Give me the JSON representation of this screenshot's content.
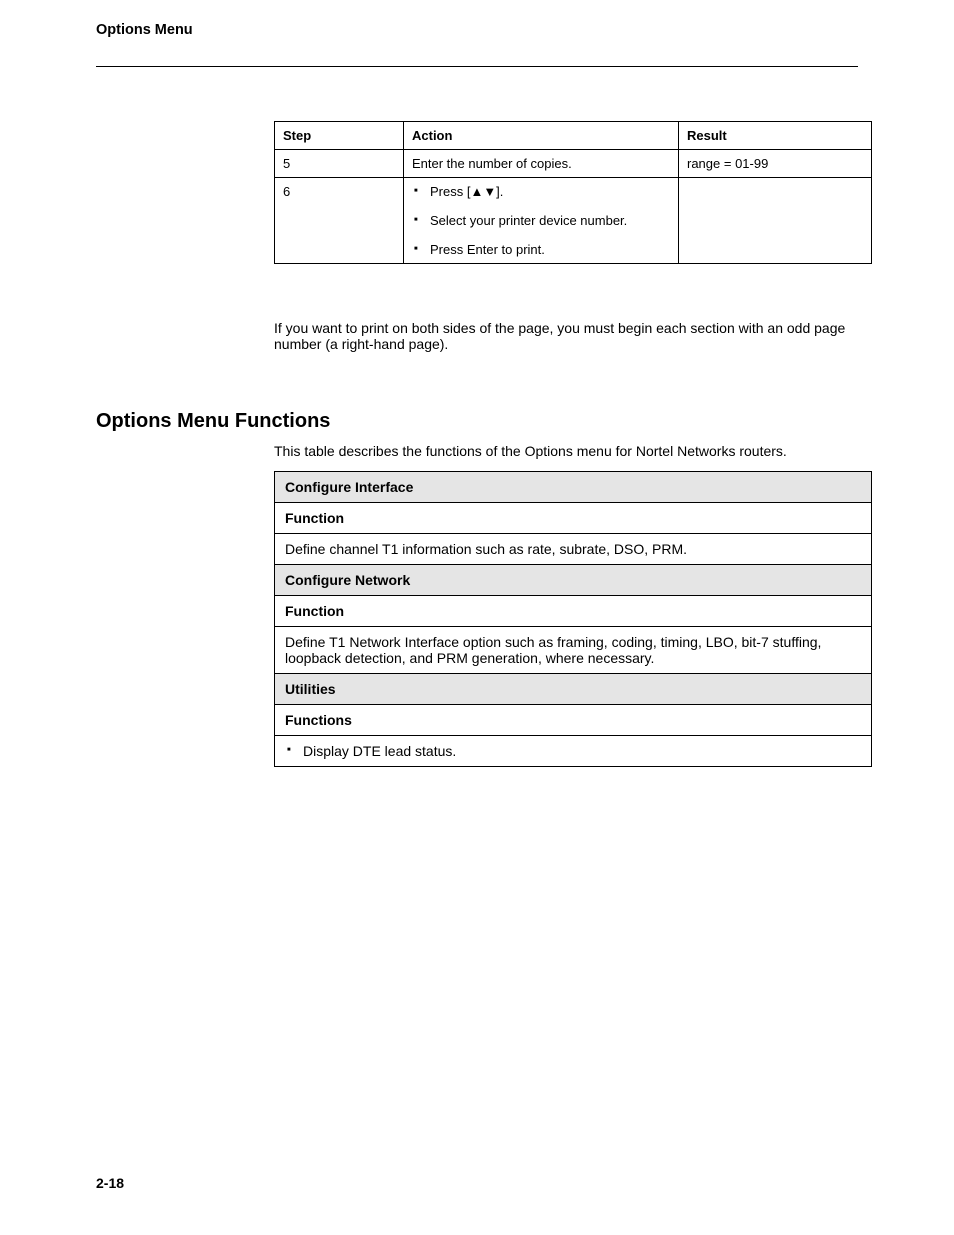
{
  "running_head": "Options Menu",
  "table1": {
    "headers": [
      "Step",
      "Action",
      "Result"
    ],
    "rows": [
      {
        "step": "5",
        "action": "Enter the number of copies.",
        "result": "range = 01-99"
      },
      {
        "step": "6",
        "actions": [
          "Press [▲▼].",
          "Select your printer device number.",
          "Press Enter to print."
        ],
        "result": ""
      }
    ]
  },
  "even_page_note": "If you want to print on both sides of the page, you must begin each section with an odd page number (a right-hand page).",
  "section_title": "Options Menu Functions",
  "functions_intro": "This table describes the functions of the Options menu for Nortel Networks routers.",
  "func_table": {
    "sections": [
      {
        "header": "Configure Interface",
        "sub": "Function",
        "body": "Define channel T1 information such as rate, subrate, DSO, PRM."
      },
      {
        "header": "Configure Network",
        "sub": "Function",
        "body": "Define T1 Network Interface option such as framing, coding, timing, LBO, bit-7 stuffing, loopback detection, and PRM generation, where necessary."
      },
      {
        "header": "Utilities",
        "sub": "Functions",
        "bullets": [
          "Display DTE lead status."
        ]
      }
    ]
  },
  "page_number": "2-18"
}
